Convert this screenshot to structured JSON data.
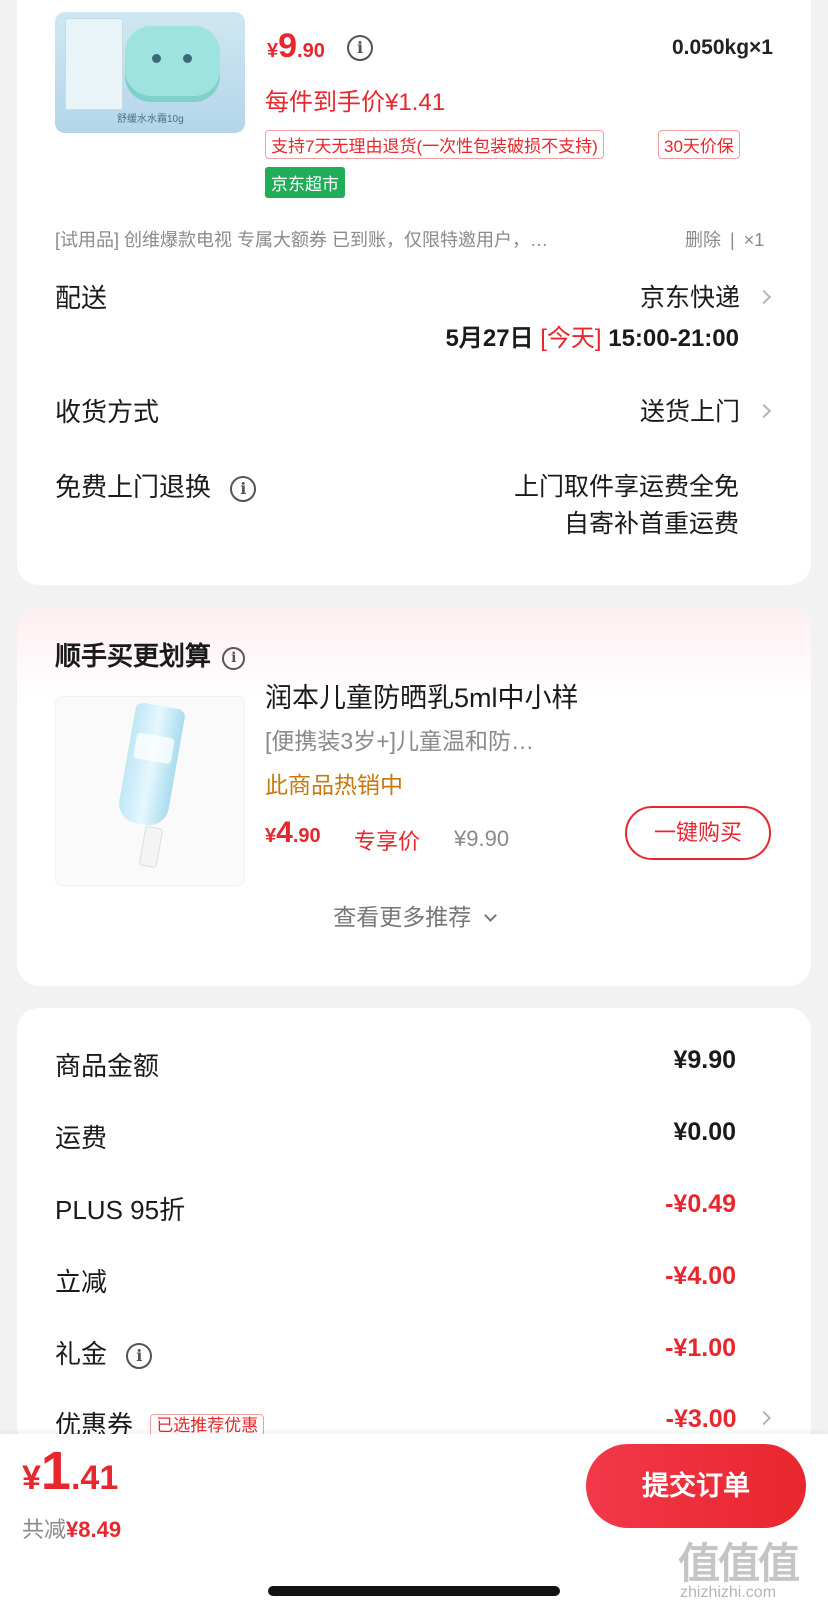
{
  "product": {
    "image_caption": "舒缓水水霜10g",
    "price_symbol": "¥",
    "price_int": "9",
    "price_dec": ".90",
    "weight_qty": "0.050kg×1",
    "per_item_price": "每件到手价¥1.41",
    "tag_return": "支持7天无理由退货(一次性包装破损不支持)",
    "tag_price_protect": "30天价保",
    "tag_store": "京东超市"
  },
  "trial_item": {
    "text": "[试用品] 创维爆款电视 专属大额券 已到账，仅限特邀用户，…",
    "delete": "删除",
    "separator": "|",
    "qty": "×1"
  },
  "delivery": {
    "label": "配送",
    "carrier": "京东快递",
    "date": "5月27日",
    "today": "[今天]",
    "time": "15:00-21:00"
  },
  "receive": {
    "label": "收货方式",
    "value": "送货上门"
  },
  "free_return": {
    "label": "免费上门退换",
    "line1": "上门取件享运费全免",
    "line2": "自寄补首重运费"
  },
  "recommend": {
    "title": "顺手买更划算",
    "product_name": "润本儿童防晒乳5ml中小样",
    "product_desc": "[便携装3岁+]儿童温和防…",
    "hot_text": "此商品热销中",
    "price_symbol": "¥",
    "price_int": "4",
    "price_dec": ".90",
    "price_label": "专享价",
    "orig_price": "¥9.90",
    "buy_button": "一键购买",
    "more": "查看更多推荐"
  },
  "summary": {
    "rows": [
      {
        "label": "商品金额",
        "value": "¥9.90"
      },
      {
        "label": "运费",
        "value": "¥0.00"
      },
      {
        "label": "PLUS 95折",
        "value": "-¥0.49"
      },
      {
        "label": "立减",
        "value": "-¥4.00"
      },
      {
        "label": "礼金",
        "value": "-¥1.00"
      },
      {
        "label": "优惠券",
        "value": "-¥3.00"
      }
    ],
    "coupon_tag": "已选推荐优惠"
  },
  "footer": {
    "total_symbol": "¥",
    "total_int": "1",
    "total_dec": ".41",
    "saved_label": "共减",
    "saved_value": "¥8.49",
    "submit": "提交订单"
  },
  "watermark": {
    "logo": "值值值",
    "url": "zhizhizhi.com"
  },
  "colors": {
    "accent": "#e8262d",
    "store_green": "#1fae57",
    "hot_orange": "#c8780c"
  }
}
